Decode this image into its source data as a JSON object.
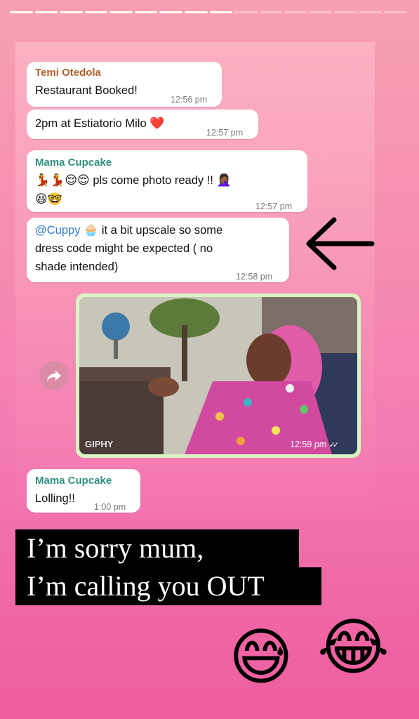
{
  "progress": {
    "segments_total": 16,
    "segments_done": 9
  },
  "chat": {
    "msg1": {
      "sender": "Temi Otedola",
      "text": "Restaurant Booked!",
      "time": "12:56 pm"
    },
    "msg2": {
      "text": "2pm at Estiatorio Milo",
      "heart": "❤️",
      "time": "12:57 pm"
    },
    "msg3": {
      "sender": "Mama Cupcake",
      "emojis_lead": "💃💃😌😌",
      "text": "pls come photo ready !!",
      "emoji_end": "🤦🏾‍♀️",
      "emojis_line2": "😆🤓",
      "time": "12:57 pm"
    },
    "msg4": {
      "mention": "@Cuppy",
      "cupcake": "🧁",
      "text_line1": "it a bit upscale so some",
      "text_line2": "dress code might be expected ( no",
      "text_line3": "shade intended)",
      "time": "12:58 pm"
    },
    "gif": {
      "watermark": "GIPHY",
      "time": "12:59 pm",
      "ticks": "✓✓"
    },
    "msg5": {
      "sender": "Mama Cupcake",
      "text": "Lolling!!",
      "time": "1:00 pm"
    }
  },
  "caption": {
    "line1": "I’m sorry mum,",
    "line2": "I’m calling you OUT"
  },
  "emojis": {
    "sweat_smile": "😅",
    "tears_of_joy": "😂"
  },
  "colors": {
    "brown_sender": "#b0612f",
    "teal_sender": "#2f8f7d",
    "gif_border": "#d7f6c4"
  }
}
